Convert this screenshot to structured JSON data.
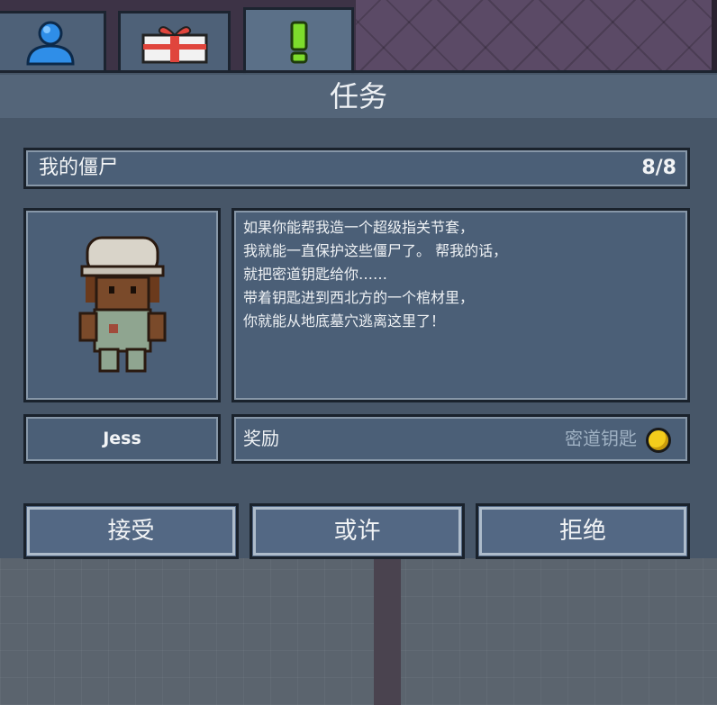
{
  "tabs": [
    {
      "icon": "person-icon"
    },
    {
      "icon": "gift-icon"
    },
    {
      "icon": "exclamation-icon",
      "active": true
    }
  ],
  "panel": {
    "title": "任务",
    "quest": {
      "label": "我的僵尸",
      "count": "8/8"
    },
    "dialog": "如果你能帮我造一个超级指关节套，\n我就能一直保护这些僵尸了。 帮我的话，\n就把密道钥匙给你……\n带着钥匙进到西北方的一个棺材里，\n你就能从地底墓穴逃离这里了！",
    "npc_name": "Jess",
    "reward": {
      "label": "奖励",
      "item": "密道钥匙",
      "icon": "coin-icon"
    },
    "buttons": {
      "accept": "接受",
      "maybe": "或许",
      "refuse": "拒绝"
    }
  },
  "colors": {
    "panel": "#475668",
    "box": "#4b5f77",
    "coin": "#f4cc1c"
  }
}
